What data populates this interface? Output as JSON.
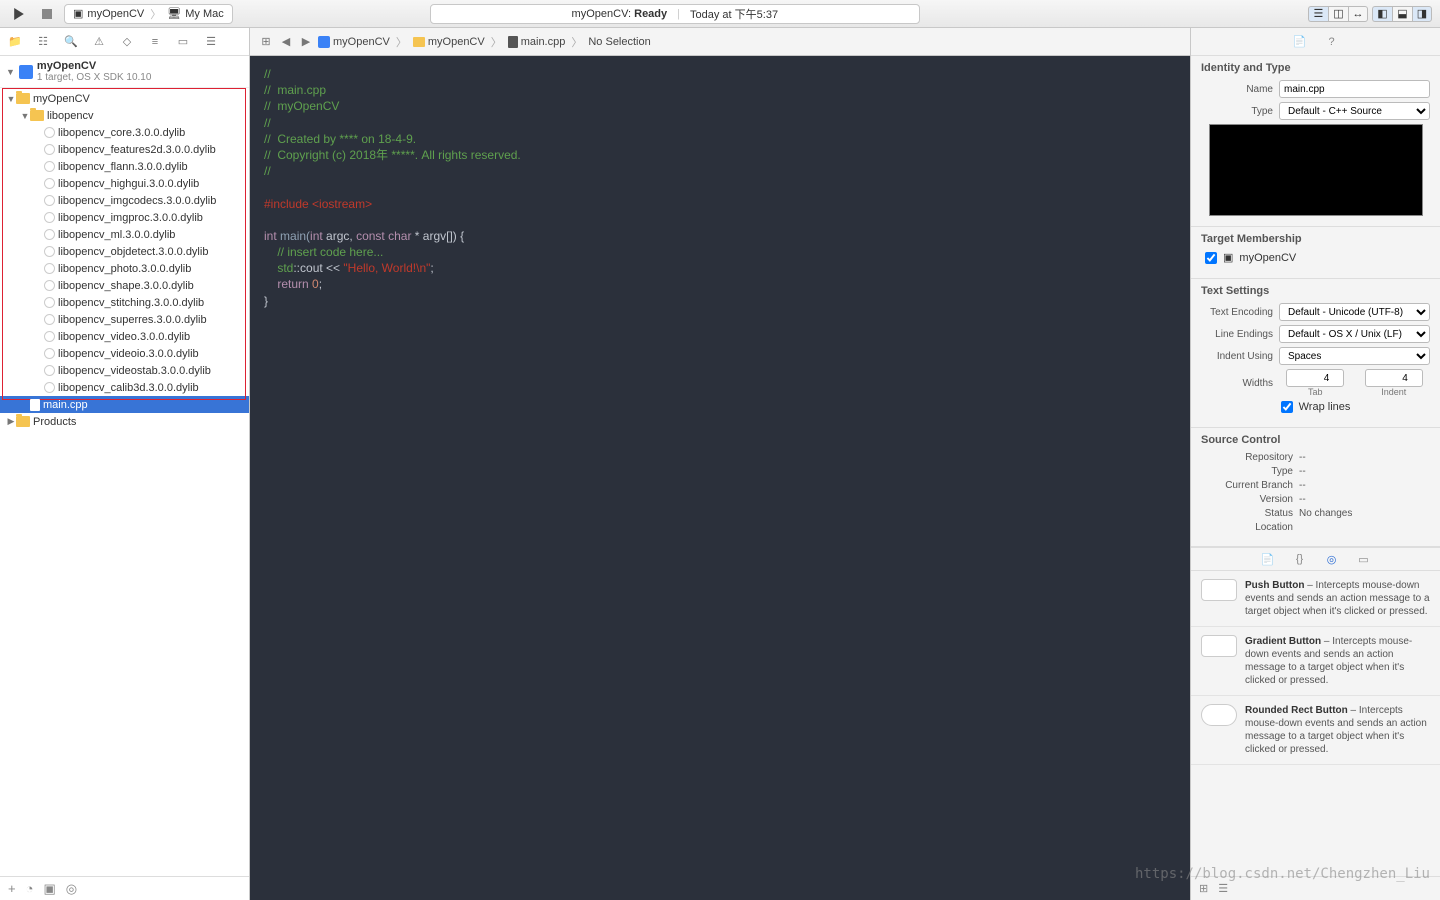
{
  "toolbar": {
    "scheme_target": "myOpenCV",
    "scheme_device": "My Mac",
    "status_project": "myOpenCV:",
    "status_state": "Ready",
    "status_time": "Today at 下午5:37"
  },
  "navigator": {
    "project_name": "myOpenCV",
    "project_sub": "1 target, OS X SDK 10.10",
    "root_folder": "myOpenCV",
    "lib_folder": "libopencv",
    "dylibs": [
      "libopencv_core.3.0.0.dylib",
      "libopencv_features2d.3.0.0.dylib",
      "libopencv_flann.3.0.0.dylib",
      "libopencv_highgui.3.0.0.dylib",
      "libopencv_imgcodecs.3.0.0.dylib",
      "libopencv_imgproc.3.0.0.dylib",
      "libopencv_ml.3.0.0.dylib",
      "libopencv_objdetect.3.0.0.dylib",
      "libopencv_photo.3.0.0.dylib",
      "libopencv_shape.3.0.0.dylib",
      "libopencv_stitching.3.0.0.dylib",
      "libopencv_superres.3.0.0.dylib",
      "libopencv_video.3.0.0.dylib",
      "libopencv_videoio.3.0.0.dylib",
      "libopencv_videostab.3.0.0.dylib",
      "libopencv_calib3d.3.0.0.dylib"
    ],
    "main_file": "main.cpp",
    "products": "Products"
  },
  "jumpbar": {
    "seg1": "myOpenCV",
    "seg2": "myOpenCV",
    "seg3": "main.cpp",
    "seg4": "No Selection"
  },
  "code": {
    "l1": "//",
    "l2": "//  main.cpp",
    "l3": "//  myOpenCV",
    "l4": "//",
    "l5": "//  Created by **** on 18-4-9.",
    "l6": "//  Copyright (c) 2018年 *****. All rights reserved.",
    "l7": "//",
    "include_pp": "#include ",
    "include_file": "<iostream>",
    "kw_int": "int",
    "fn_main": " main(",
    "kw_int2": "int",
    "arg1": " argc, ",
    "kw_const": "const",
    "kw_char": " char",
    "argrest": " * argv[]) {",
    "insert_cmt": "    // insert code here...",
    "std": "    std",
    "coloncolon": "::",
    "cout": "cout << ",
    "hello": "\"Hello, World!\\n\"",
    "semi": ";",
    "kw_return": "    return ",
    "zero": "0",
    "semi2": ";",
    "close": "}"
  },
  "inspector": {
    "identity_title": "Identity and Type",
    "name_label": "Name",
    "name_value": "main.cpp",
    "type_label": "Type",
    "type_value": "Default - C++ Source",
    "target_title": "Target Membership",
    "target_name": "myOpenCV",
    "text_title": "Text Settings",
    "enc_label": "Text Encoding",
    "enc_value": "Default - Unicode (UTF-8)",
    "endings_label": "Line Endings",
    "endings_value": "Default - OS X / Unix (LF)",
    "indent_label": "Indent Using",
    "indent_value": "Spaces",
    "widths_label": "Widths",
    "tab_value": "4",
    "tab_label": "Tab",
    "indent_value_num": "4",
    "indent_num_label": "Indent",
    "wrap_label": "Wrap lines",
    "sc_title": "Source Control",
    "sc_repo_l": "Repository",
    "sc_repo_v": "--",
    "sc_type_l": "Type",
    "sc_type_v": "--",
    "sc_branch_l": "Current Branch",
    "sc_branch_v": "--",
    "sc_ver_l": "Version",
    "sc_ver_v": "--",
    "sc_status_l": "Status",
    "sc_status_v": "No changes",
    "sc_loc_l": "Location",
    "sc_loc_v": ""
  },
  "library": [
    {
      "title": "Push Button",
      "desc": " – Intercepts mouse-down events and sends an action message to a target object when it's clicked or pressed."
    },
    {
      "title": "Gradient Button",
      "desc": " – Intercepts mouse-down events and sends an action message to a target object when it's clicked or pressed."
    },
    {
      "title": "Rounded Rect Button",
      "desc": " – Intercepts mouse-down events and sends an action message to a target object when it's clicked or pressed."
    }
  ],
  "watermark": "https://blog.csdn.net/Chengzhen_Liu"
}
